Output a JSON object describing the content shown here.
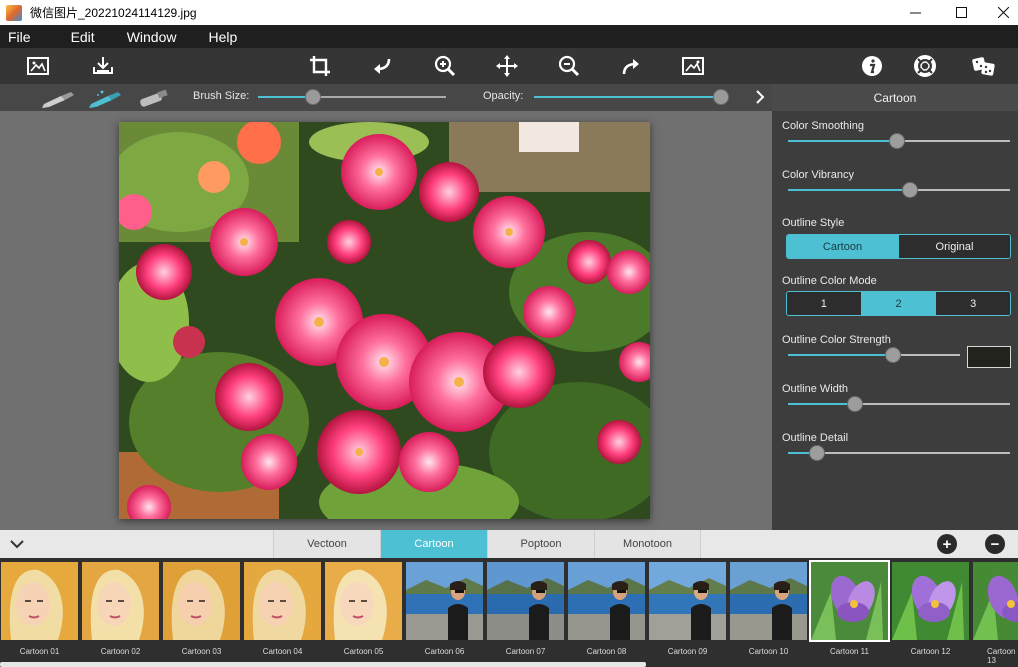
{
  "window": {
    "title": "微信图片_20221024114129.jpg"
  },
  "menu": {
    "items": [
      "File",
      "Edit",
      "Window",
      "Help"
    ]
  },
  "toolbar": {
    "icons": [
      "open-image-icon",
      "save-icon",
      "crop-icon",
      "undo-icon",
      "zoom-in-icon",
      "move-icon",
      "zoom-out-icon",
      "redo-icon",
      "compare-icon",
      "info-icon",
      "help-icon",
      "random-icon"
    ]
  },
  "brushbar": {
    "brush_size_label": "Brush Size:",
    "opacity_label": "Opacity:",
    "brush_size_value": 0.29,
    "opacity_value": 1.0
  },
  "panel": {
    "title": "Cartoon",
    "color_smoothing_label": "Color Smoothing",
    "color_smoothing_value": 0.49,
    "color_vibrancy_label": "Color Vibrancy",
    "color_vibrancy_value": 0.55,
    "outline_style_label": "Outline Style",
    "outline_style_options": [
      "Cartoon",
      "Original"
    ],
    "outline_style_selected": "Cartoon",
    "outline_color_mode_label": "Outline Color Mode",
    "outline_color_mode_options": [
      "1",
      "2",
      "3"
    ],
    "outline_color_mode_selected": "2",
    "outline_color_strength_label": "Outline Color Strength",
    "outline_color_strength_value": 0.61,
    "outline_color": "#23231e",
    "outline_width_label": "Outline Width",
    "outline_width_value": 0.3,
    "outline_detail_label": "Outline Detail",
    "outline_detail_value": 0.13
  },
  "preset_tabs": {
    "items": [
      "Vectoon",
      "Cartoon",
      "Poptoon",
      "Monotoon"
    ],
    "selected": "Cartoon"
  },
  "thumbnails": {
    "items": [
      "Cartoon 01",
      "Cartoon 02",
      "Cartoon 03",
      "Cartoon 04",
      "Cartoon 05",
      "Cartoon 06",
      "Cartoon 07",
      "Cartoon 08",
      "Cartoon 09",
      "Cartoon 10",
      "Cartoon 11",
      "Cartoon 12",
      "Cartoon 13"
    ],
    "selected": "Cartoon 11"
  },
  "colors": {
    "accent": "#4dc0d4"
  }
}
